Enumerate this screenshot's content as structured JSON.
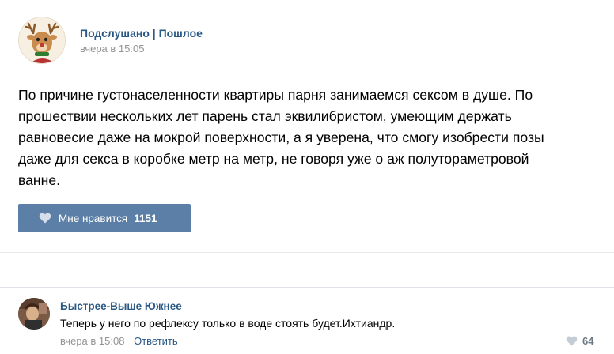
{
  "post": {
    "author": "Подслушано | Пошлое",
    "time": "вчера в 15:05",
    "avatar_icon": "deer-avatar-icon",
    "text": "По причине густонаселенности квартиры парня занимаемся сексом в душе. По прошествии нескольких лет парень стал эквилибристом, умеющим держать равновесие даже на мокрой поверхности, а я уверена, что смогу изобрести позы даже для секса в коробке метр на метр, не говоря уже о аж полутораметровой ванне.",
    "like_label": "Мне нравится",
    "like_count": "1151",
    "like_icon": "heart-icon"
  },
  "comment": {
    "author": "Быстрее-Выше Южнее",
    "text": "Теперь у него по рефлексу только в воде стоять будет.Ихтиандр.",
    "time": "вчера в 15:08",
    "reply_label": "Ответить",
    "like_count": "64",
    "like_icon": "heart-icon"
  },
  "colors": {
    "link": "#2a5885",
    "button": "#5b7fa6",
    "muted": "#939393",
    "divider": "#e7e8ec"
  }
}
